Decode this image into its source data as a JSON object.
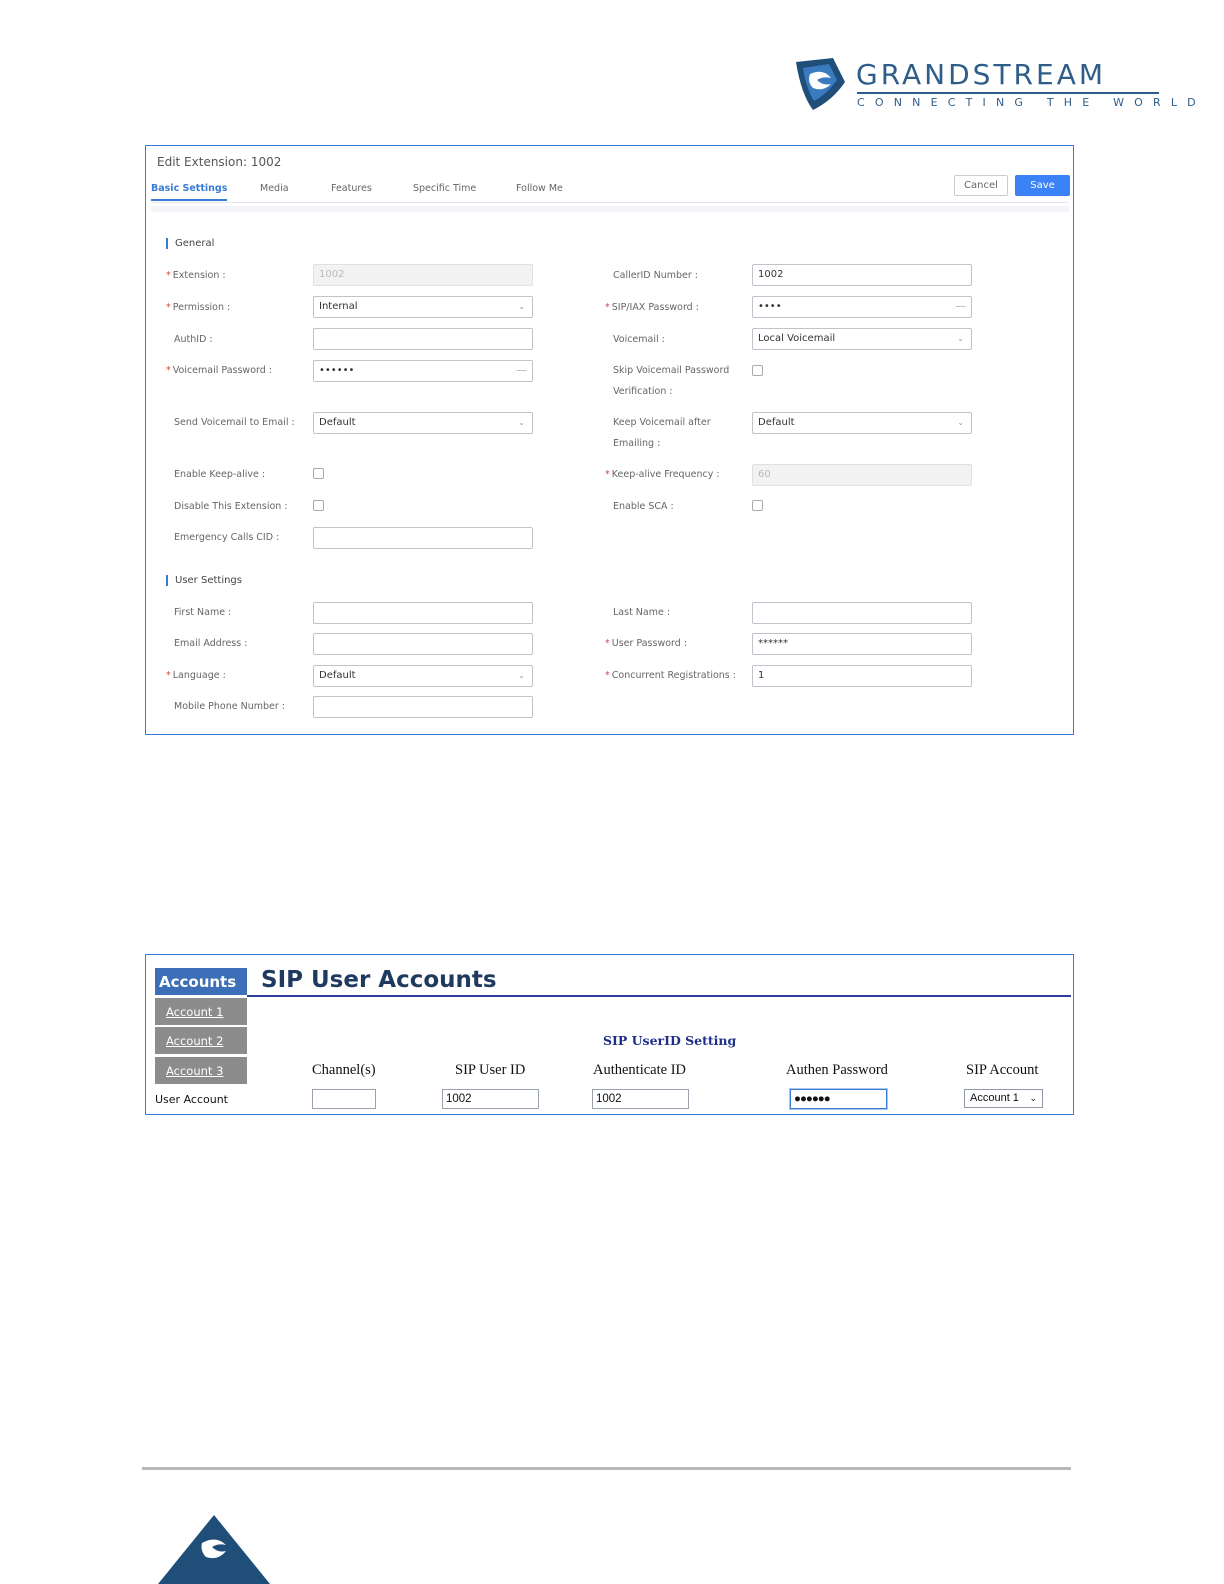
{
  "logo": {
    "name": "GRANDSTREAM",
    "tagline": "CONNECTING THE WORLD",
    "brand_color": "#2e5d8a"
  },
  "edit_extension": {
    "title": "Edit Extension: 1002",
    "tabs": [
      {
        "label": "Basic Settings",
        "active": true
      },
      {
        "label": "Media",
        "active": false
      },
      {
        "label": "Features",
        "active": false
      },
      {
        "label": "Specific Time",
        "active": false
      },
      {
        "label": "Follow Me",
        "active": false
      }
    ],
    "cancel_label": "Cancel",
    "save_label": "Save",
    "accent_color": "#3b82f6",
    "general": {
      "title": "General",
      "extension": {
        "label": "Extension :",
        "value": "1002"
      },
      "callerid_number": {
        "label": "CallerID Number :",
        "value": "1002"
      },
      "permission": {
        "label": "Permission :",
        "value": "Internal"
      },
      "sip_iax_password": {
        "label": "SIP/IAX Password :",
        "value": "••••"
      },
      "authid": {
        "label": "AuthID :",
        "value": ""
      },
      "voicemail": {
        "label": "Voicemail :",
        "value": "Local Voicemail"
      },
      "voicemail_password": {
        "label": "Voicemail Password :",
        "value": "••••••"
      },
      "skip_voicemail_password": {
        "label_line1": "Skip Voicemail Password",
        "label_line2": "Verification :",
        "checked": false
      },
      "send_voicemail_email": {
        "label": "Send Voicemail to Email :",
        "value": "Default"
      },
      "keep_voicemail": {
        "label_line1": "Keep Voicemail after",
        "label_line2": "Emailing :",
        "value": "Default"
      },
      "enable_keepalive": {
        "label": "Enable Keep-alive :",
        "checked": false
      },
      "keepalive_frequency": {
        "label": "Keep-alive Frequency :",
        "value": "60"
      },
      "disable_extension": {
        "label": "Disable This Extension :",
        "checked": false
      },
      "enable_sca": {
        "label": "Enable SCA :",
        "checked": false
      },
      "emergency_cid": {
        "label": "Emergency Calls CID :",
        "value": ""
      }
    },
    "user_settings": {
      "title": "User Settings",
      "first_name": {
        "label": "First Name :",
        "value": ""
      },
      "last_name": {
        "label": "Last Name :",
        "value": ""
      },
      "email": {
        "label": "Email Address :",
        "value": ""
      },
      "user_password": {
        "label": "User Password :",
        "value": "******"
      },
      "language": {
        "label": "Language :",
        "value": "Default"
      },
      "concurrent_registrations": {
        "label": "Concurrent Registrations :",
        "value": "1"
      },
      "mobile_phone": {
        "label": "Mobile Phone Number :",
        "value": ""
      }
    }
  },
  "sip_accounts": {
    "sidebar_header": "Accounts",
    "sidebar_items": [
      "Account 1",
      "Account 2",
      "Account 3"
    ],
    "title": "SIP User Accounts",
    "subtitle": "SIP UserID Setting",
    "columns": [
      "Channel(s)",
      "SIP User ID",
      "Authenticate ID",
      "Authen Password",
      "SIP Account"
    ],
    "row_label": "User Account",
    "channels": "",
    "sip_user_id": "1002",
    "authenticate_id": "1002",
    "authen_password": "●●●●●●",
    "sip_account": "Account 1",
    "header_color": "#3d6fb8"
  }
}
